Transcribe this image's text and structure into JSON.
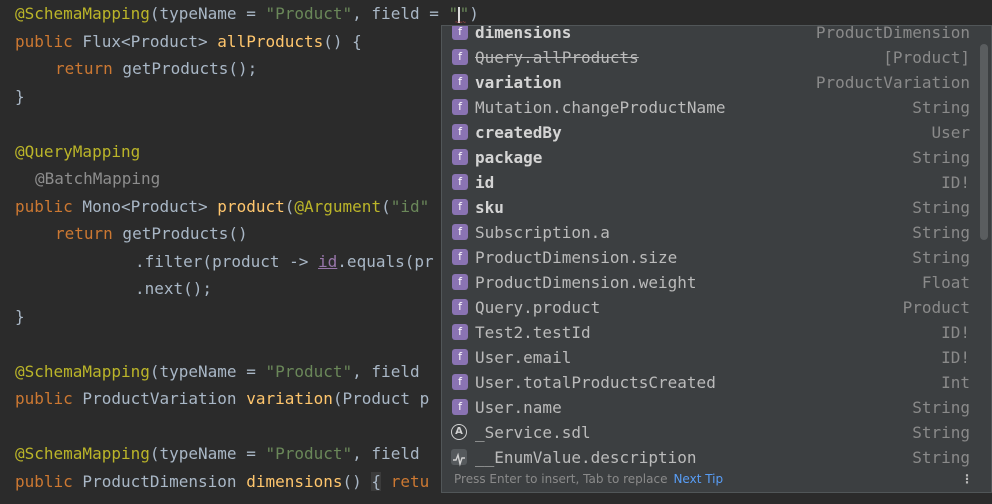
{
  "code": {
    "l1": {
      "ann": "@SchemaMapping",
      "p1": "(typeName = ",
      "s1": "\"Product\"",
      "p2": ", field = ",
      "s2": "\"",
      "s3": "\"",
      "p3": ")"
    },
    "l2": {
      "kw": "public",
      "p1": " Flux<Product> ",
      "fn": "allProducts",
      "p2": "() {"
    },
    "l3": {
      "kw": "return",
      "p1": " getProducts();"
    },
    "l4": {
      "p1": "}"
    },
    "l6": {
      "ann": "@QueryMapping"
    },
    "l7": {
      "ann": "@BatchMapping"
    },
    "l8": {
      "kw": "public",
      "p1": " Mono<Product> ",
      "fn": "product",
      "p2": "(",
      "ann": "@Argument",
      "p3": "(",
      "s1": "\"id\""
    },
    "l9": {
      "kw": "return",
      "p1": " getProducts()"
    },
    "l10": {
      "p1": ".filter(product -> ",
      "u": "id",
      "p2": ".equals(pr"
    },
    "l11": {
      "p1": ".next();"
    },
    "l12": {
      "p1": "}"
    },
    "l14": {
      "ann": "@SchemaMapping",
      "p1": "(typeName = ",
      "s1": "\"Product\"",
      "p2": ", field"
    },
    "l15": {
      "kw": "public",
      "p1": " ProductVariation ",
      "fn": "variation",
      "p2": "(Product p"
    },
    "l17": {
      "ann": "@SchemaMapping",
      "p1": "(typeName = ",
      "s1": "\"Product\"",
      "p2": ", field"
    },
    "l18": {
      "kw": "public",
      "p1": " ProductDimension ",
      "fn": "dimensions",
      "p2": "() ",
      "brace": "{",
      "p3": " retu"
    },
    "edge": "n"
  },
  "popup": {
    "items": [
      {
        "icon": "f",
        "name": "dimensions",
        "type": "ProductDimension",
        "bold": true
      },
      {
        "icon": "f",
        "name": "Query.allProducts",
        "type": "[Product]",
        "strike": true
      },
      {
        "icon": "f",
        "name": "variation",
        "type": "ProductVariation",
        "bold": true
      },
      {
        "icon": "f",
        "name": "Mutation.changeProductName",
        "type": "String"
      },
      {
        "icon": "f",
        "name": "createdBy",
        "type": "User",
        "bold": true
      },
      {
        "icon": "f",
        "name": "package",
        "type": "String",
        "bold": true
      },
      {
        "icon": "f",
        "name": "id",
        "type": "ID!",
        "bold": true
      },
      {
        "icon": "f",
        "name": "sku",
        "type": "String",
        "bold": true
      },
      {
        "icon": "f",
        "name": "Subscription.a",
        "type": "String"
      },
      {
        "icon": "f",
        "name": "ProductDimension.size",
        "type": "String"
      },
      {
        "icon": "f",
        "name": "ProductDimension.weight",
        "type": "Float"
      },
      {
        "icon": "f",
        "name": "Query.product",
        "type": "Product"
      },
      {
        "icon": "f",
        "name": "Test2.testId",
        "type": "ID!"
      },
      {
        "icon": "f",
        "name": "User.email",
        "type": "ID!"
      },
      {
        "icon": "f",
        "name": "User.totalProductsCreated",
        "type": "Int"
      },
      {
        "icon": "f",
        "name": "User.name",
        "type": "String"
      },
      {
        "icon": "A",
        "name": "_Service.sdl",
        "type": "String"
      },
      {
        "icon": "",
        "name": "__EnumValue.description",
        "type": "String"
      }
    ],
    "footer_hint": "Press Enter to insert, Tab to replace",
    "footer_link": "Next Tip",
    "more_icon": "⋮"
  },
  "colors": {
    "accent_badge": "#8a73b3",
    "link": "#589df6",
    "annotation": "#bbb529",
    "keyword": "#cc7832",
    "string": "#6a8759",
    "function": "#ffc66d"
  }
}
